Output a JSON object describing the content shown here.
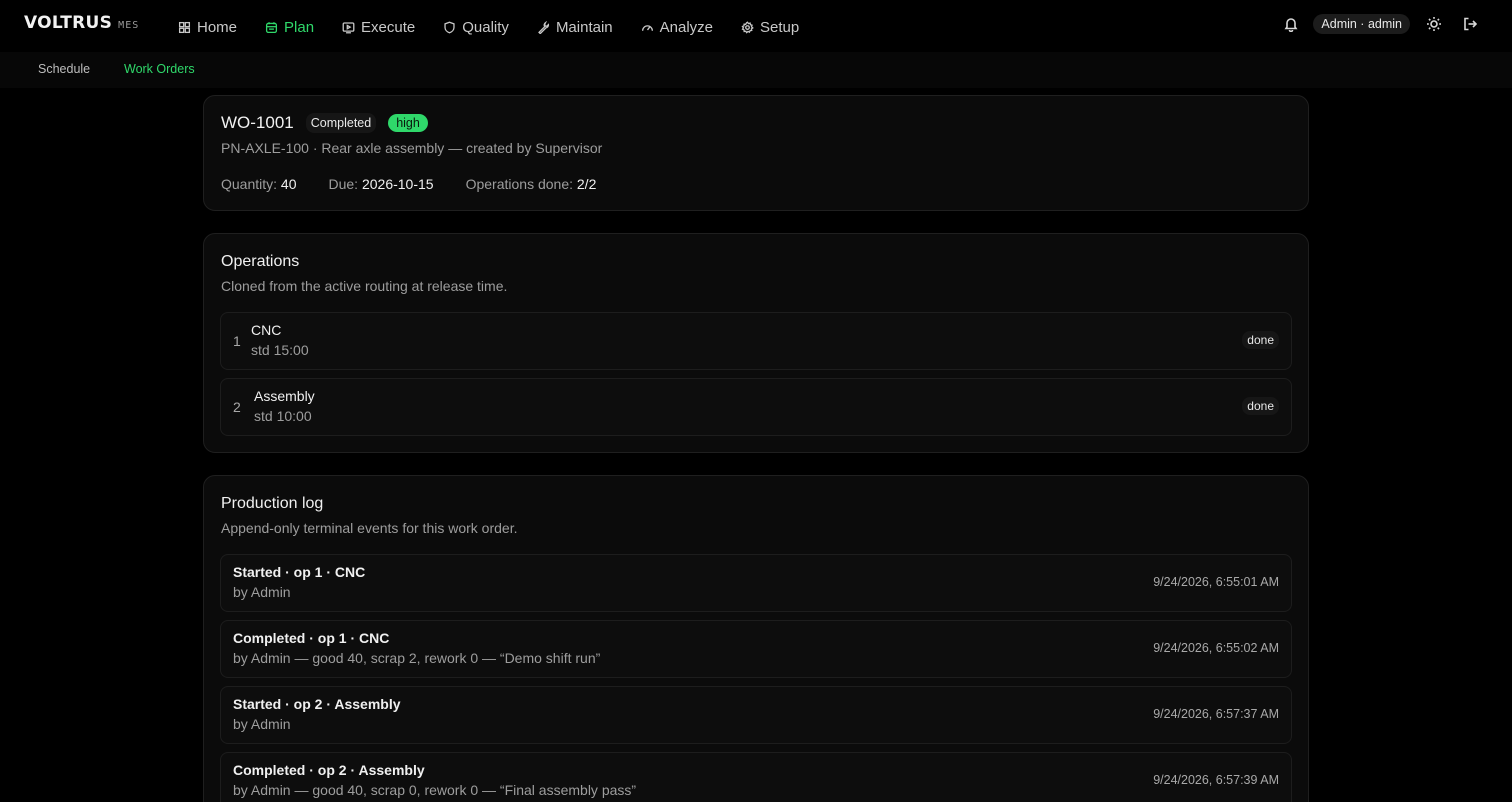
{
  "brand": {
    "name": "VOLTRUS",
    "suffix": "MES"
  },
  "nav": [
    {
      "label": "Home",
      "icon": "grid-icon"
    },
    {
      "label": "Plan",
      "icon": "calendar-icon",
      "active": true
    },
    {
      "label": "Execute",
      "icon": "play-icon"
    },
    {
      "label": "Quality",
      "icon": "shield-icon"
    },
    {
      "label": "Maintain",
      "icon": "wrench-icon"
    },
    {
      "label": "Analyze",
      "icon": "gauge-icon"
    },
    {
      "label": "Setup",
      "icon": "gear-icon"
    }
  ],
  "user": {
    "label": "Admin · admin"
  },
  "subnav": [
    {
      "label": "Schedule"
    },
    {
      "label": "Work Orders",
      "active": true
    }
  ],
  "work_order": {
    "id": "WO-1001",
    "status": "Completed",
    "priority": "high",
    "subtitle": "PN-AXLE-100 · Rear axle assembly — created by Supervisor",
    "quantity_label": "Quantity:",
    "quantity": "40",
    "due_label": "Due:",
    "due": "2026-10-15",
    "ops_label": "Operations done:",
    "ops_done": "2/2"
  },
  "operations": {
    "title": "Operations",
    "description": "Cloned from the active routing at release time.",
    "items": [
      {
        "num": "1",
        "name": "CNC",
        "std": "std 15:00",
        "status": "done"
      },
      {
        "num": "2",
        "name": "Assembly",
        "std": "std 10:00",
        "status": "done"
      }
    ]
  },
  "production_log": {
    "title": "Production log",
    "description": "Append-only terminal events for this work order.",
    "entries": [
      {
        "title": "Started · op 1 · CNC",
        "detail": "by Admin",
        "time": "9/24/2026, 6:55:01 AM"
      },
      {
        "title": "Completed · op 1 · CNC",
        "detail": "by Admin — good 40, scrap 2, rework 0 — “Demo shift run”",
        "time": "9/24/2026, 6:55:02 AM"
      },
      {
        "title": "Started · op 2 · Assembly",
        "detail": "by Admin",
        "time": "9/24/2026, 6:57:37 AM"
      },
      {
        "title": "Completed · op 2 · Assembly",
        "detail": "by Admin — good 40, scrap 0, rework 0 — “Final assembly pass”",
        "time": "9/24/2026, 6:57:39 AM"
      }
    ]
  },
  "colors": {
    "accent": "#2fd86a",
    "background": "#000000",
    "card": "#0b0b0b"
  }
}
